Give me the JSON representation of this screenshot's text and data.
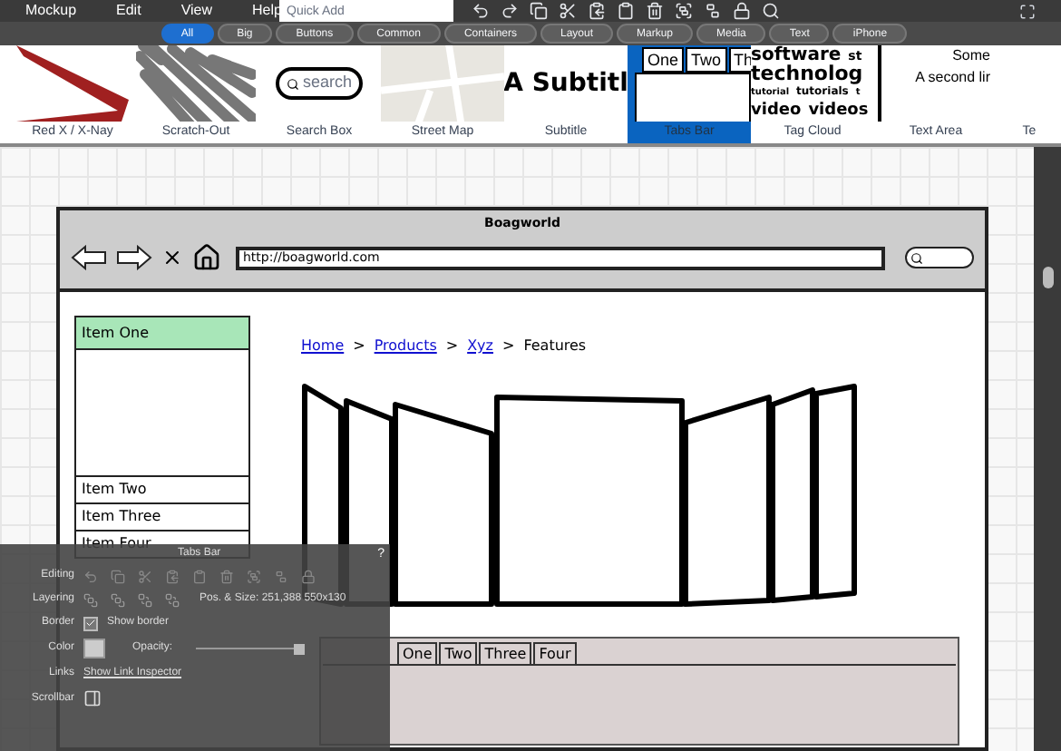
{
  "menu": [
    "Mockup",
    "Edit",
    "View",
    "Help"
  ],
  "quick_add": {
    "placeholder": "Quick Add"
  },
  "filters": [
    {
      "label": "All",
      "selected": true
    },
    {
      "label": "Big",
      "selected": false
    },
    {
      "label": "Buttons",
      "selected": false
    },
    {
      "label": "Common",
      "selected": false
    },
    {
      "label": "Containers",
      "selected": false
    },
    {
      "label": "Layout",
      "selected": false
    },
    {
      "label": "Markup",
      "selected": false
    },
    {
      "label": "Media",
      "selected": false
    },
    {
      "label": "Text",
      "selected": false
    },
    {
      "label": "iPhone",
      "selected": false
    }
  ],
  "components": [
    {
      "label": "Red X / X-Nay",
      "kind": "redx",
      "selected": false
    },
    {
      "label": "Scratch-Out",
      "kind": "scratch",
      "selected": false
    },
    {
      "label": "Search Box",
      "kind": "search",
      "selected": false,
      "texts": [
        "search"
      ]
    },
    {
      "label": "Street Map",
      "kind": "map",
      "selected": false
    },
    {
      "label": "Subtitle",
      "kind": "subtitle",
      "selected": false,
      "texts": [
        "A Subtitl"
      ]
    },
    {
      "label": "Tabs Bar",
      "kind": "tabs",
      "selected": true,
      "texts": [
        "One",
        "Two",
        "Th"
      ]
    },
    {
      "label": "Tag Cloud",
      "kind": "cloud",
      "selected": false,
      "texts": [
        "software",
        "st",
        "technolog",
        "tutorial",
        "tutorials",
        "t",
        "video",
        "videos"
      ]
    },
    {
      "label": "Text Area",
      "kind": "textarea",
      "selected": false,
      "texts": [
        "Some",
        "A second lir"
      ]
    },
    {
      "label": "Te",
      "kind": "blank",
      "selected": false
    }
  ],
  "mockup": {
    "title": "Boagworld",
    "url": "http://boagworld.com",
    "list": [
      {
        "label": "Item One",
        "selected": true
      },
      {
        "label": "Item Two",
        "selected": false
      },
      {
        "label": "Item Three",
        "selected": false
      },
      {
        "label": "Item Four",
        "selected": false
      }
    ],
    "separator": ">",
    "breadcrumb": [
      {
        "label": "Home",
        "link": true
      },
      {
        "label": "Products",
        "link": true
      },
      {
        "label": "Xyz",
        "link": true
      },
      {
        "label": "Features",
        "link": false
      }
    ],
    "tabs": [
      "One",
      "Two",
      "Three",
      "Four"
    ]
  },
  "inspector": {
    "title": "Tabs Bar",
    "help": "?",
    "editing": "Editing",
    "layering": "Layering",
    "pos_size": "Pos. & Size: 251,388 550x130",
    "border": "Border",
    "border_checked": true,
    "show_border": "Show border",
    "color_label": "Color",
    "opacity": "Opacity:",
    "level": 1,
    "links": "Links",
    "link_inspector": "Show Link Inspector",
    "scrollbar": "Scrollbar"
  }
}
